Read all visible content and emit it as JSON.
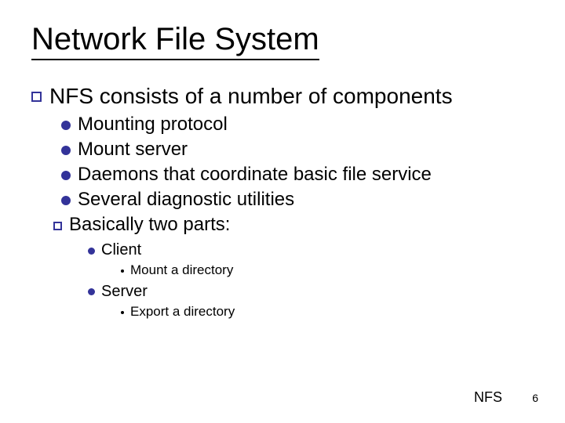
{
  "title": "Network File System",
  "l1_a": "NFS consists of a number of components",
  "l2_a": "Mounting protocol",
  "l2_b": "Mount server",
  "l2_c": "Daemons that coordinate basic file service",
  "l2_d": "Several diagnostic utilities",
  "l1_b": "Basically two parts:",
  "l3_a": "Client",
  "l4_a": "Mount a directory",
  "l3_b": "Server",
  "l4_b": "Export a directory",
  "footer_label": "NFS",
  "footer_num": "6"
}
